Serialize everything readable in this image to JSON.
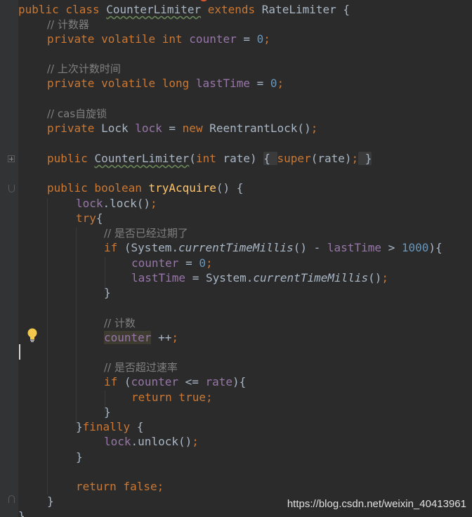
{
  "editor": {
    "language": "java",
    "caret_line": 23,
    "lines": [
      [
        [
          "public class ",
          "kw"
        ],
        [
          "CounterLimiter",
          "wave"
        ],
        [
          " extends ",
          "kw"
        ],
        [
          "RateLimiter {",
          ""
        ]
      ],
      [
        [
          "// 计数器",
          "cm"
        ]
      ],
      [
        [
          "private volatile int ",
          "kw"
        ],
        [
          "counter",
          "field"
        ],
        [
          " = ",
          ""
        ],
        [
          "0",
          "num"
        ],
        [
          ";",
          "kw"
        ]
      ],
      [],
      [
        [
          "// 上次计数时间",
          "cm"
        ]
      ],
      [
        [
          "private volatile long ",
          "kw"
        ],
        [
          "lastTime",
          "field"
        ],
        [
          " = ",
          ""
        ],
        [
          "0",
          "num"
        ],
        [
          ";",
          "kw"
        ]
      ],
      [],
      [
        [
          "// cas自旋锁",
          "cm"
        ]
      ],
      [
        [
          "private ",
          "kw"
        ],
        [
          "Lock ",
          ""
        ],
        [
          "lock",
          "field"
        ],
        [
          " = ",
          ""
        ],
        [
          "new ",
          "kw"
        ],
        [
          "ReentrantLock()",
          ""
        ],
        [
          ";",
          "kw"
        ]
      ],
      [],
      [
        [
          "public ",
          "kw"
        ],
        [
          "CounterLimiter",
          "wave"
        ],
        [
          "(",
          ""
        ],
        [
          "int ",
          "kw"
        ],
        [
          "rate) ",
          ""
        ],
        [
          "{ ",
          "fold"
        ],
        [
          "super",
          "kw"
        ],
        [
          "(rate)",
          ""
        ],
        [
          ";",
          "kw"
        ],
        [
          " }",
          "fold"
        ]
      ],
      [],
      [
        [
          "public boolean ",
          "kw"
        ],
        [
          "tryAcquire",
          "fn"
        ],
        [
          "() {",
          ""
        ]
      ],
      [
        [
          "lock",
          "field"
        ],
        [
          ".lock()",
          ""
        ],
        [
          ";",
          "kw"
        ]
      ],
      [
        [
          "try",
          "kw"
        ],
        [
          "{",
          ""
        ]
      ],
      [
        [
          "// 是否已经过期了",
          "cm"
        ]
      ],
      [
        [
          "if ",
          "kw"
        ],
        [
          "(System.",
          ""
        ],
        [
          "currentTimeMillis",
          "it"
        ],
        [
          "() - ",
          ""
        ],
        [
          "lastTime",
          "field"
        ],
        [
          " > ",
          ""
        ],
        [
          "1000",
          "num"
        ],
        [
          "){",
          ""
        ]
      ],
      [
        [
          "counter",
          "field"
        ],
        [
          " = ",
          ""
        ],
        [
          "0",
          "num"
        ],
        [
          ";",
          "kw"
        ]
      ],
      [
        [
          "lastTime",
          "field"
        ],
        [
          " = System.",
          ""
        ],
        [
          "currentTimeMillis",
          "it"
        ],
        [
          "()",
          ""
        ],
        [
          ";",
          "kw"
        ]
      ],
      [
        [
          "}",
          ""
        ]
      ],
      [],
      [
        [
          "// 计数",
          "cm"
        ]
      ],
      [
        [
          "counter",
          "field hl"
        ],
        [
          " ++",
          ""
        ],
        [
          ";",
          "kw"
        ]
      ],
      [],
      [
        [
          "// 是否超过速率",
          "cm"
        ]
      ],
      [
        [
          "if ",
          "kw"
        ],
        [
          "(",
          ""
        ],
        [
          "counter",
          "field"
        ],
        [
          " <= ",
          ""
        ],
        [
          "rate",
          "field"
        ],
        [
          "){",
          ""
        ]
      ],
      [
        [
          "return true",
          "kw"
        ],
        [
          ";",
          "kw"
        ]
      ],
      [
        [
          "}",
          ""
        ]
      ],
      [
        [
          "}",
          ""
        ],
        [
          "finally ",
          "kw"
        ],
        [
          "{",
          ""
        ]
      ],
      [
        [
          "lock",
          "field"
        ],
        [
          ".unlock()",
          ""
        ],
        [
          ";",
          "kw"
        ]
      ],
      [
        [
          "}",
          ""
        ]
      ],
      [],
      [
        [
          "return false",
          "kw"
        ],
        [
          ";",
          "kw"
        ]
      ],
      [
        [
          "}",
          ""
        ]
      ],
      [
        [
          "}",
          ""
        ]
      ]
    ]
  },
  "watermark": "https://blog.csdn.net/weixin_40413961",
  "icons": {
    "gutter_hint": "lightbulb-icon"
  }
}
